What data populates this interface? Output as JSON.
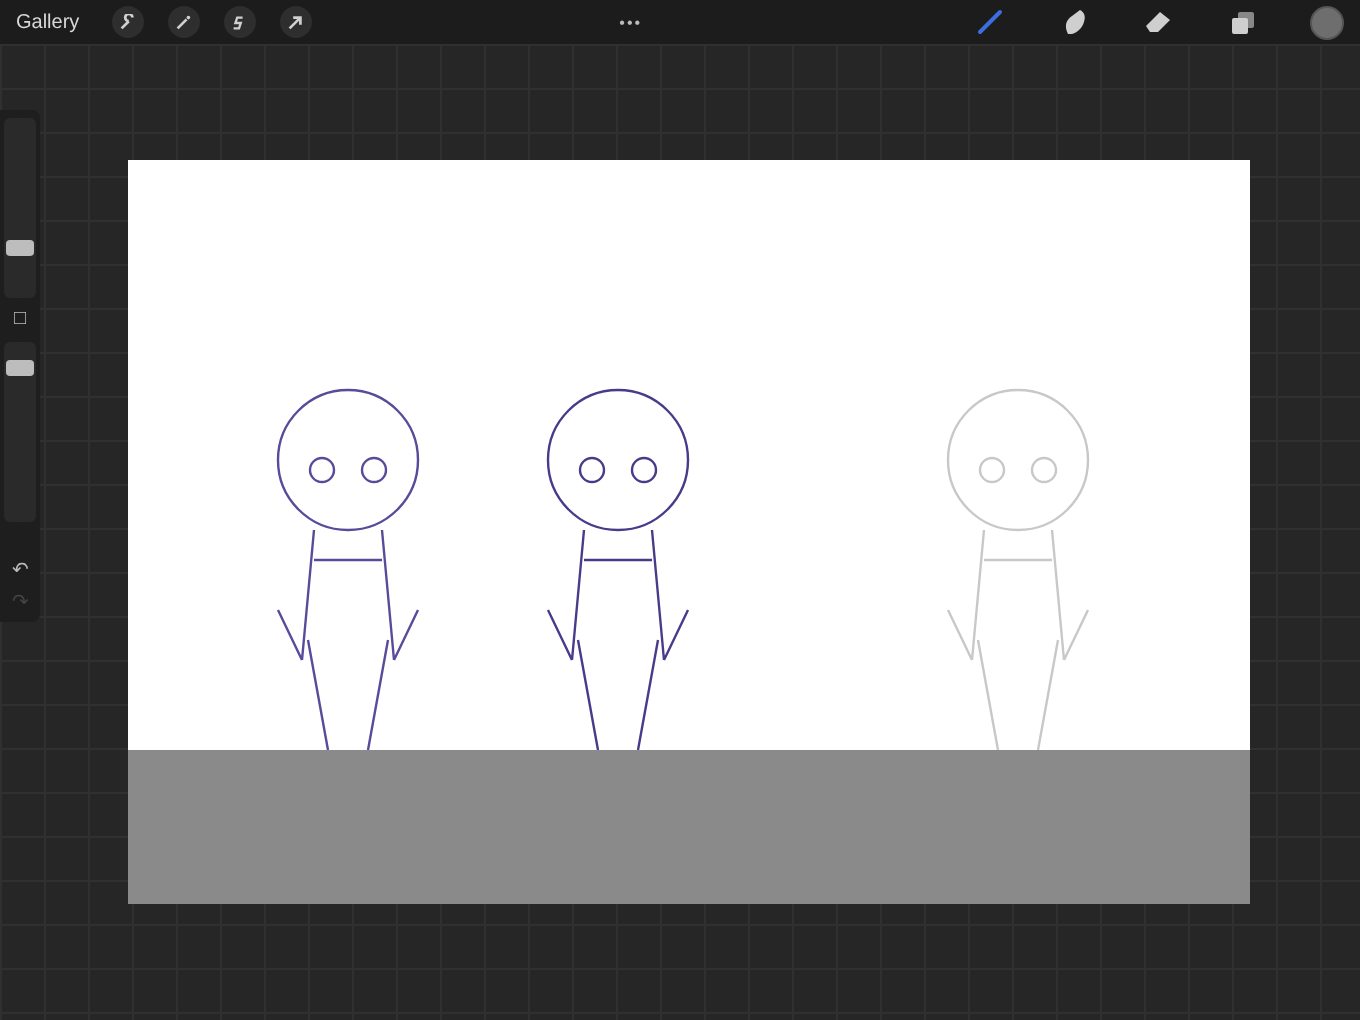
{
  "top_bar": {
    "gallery": "Gallery",
    "left_tools": [
      {
        "kind": "wrench"
      },
      {
        "kind": "wand"
      },
      {
        "kind": "selection"
      },
      {
        "kind": "arrow"
      }
    ],
    "more": "•••",
    "right_tools": [
      {
        "kind": "brush",
        "selected": true
      },
      {
        "kind": "smudge",
        "selected": false
      },
      {
        "kind": "eraser",
        "selected": false
      },
      {
        "kind": "layers",
        "selected": false
      }
    ],
    "color": "#6e6e6e"
  },
  "sidebar": {
    "size_slider": {
      "level": 0.28
    },
    "opacity_slider": {
      "level": 0.86
    },
    "modify": "□",
    "undo": "↶",
    "redo": "↷",
    "redo_disabled": true
  }
}
